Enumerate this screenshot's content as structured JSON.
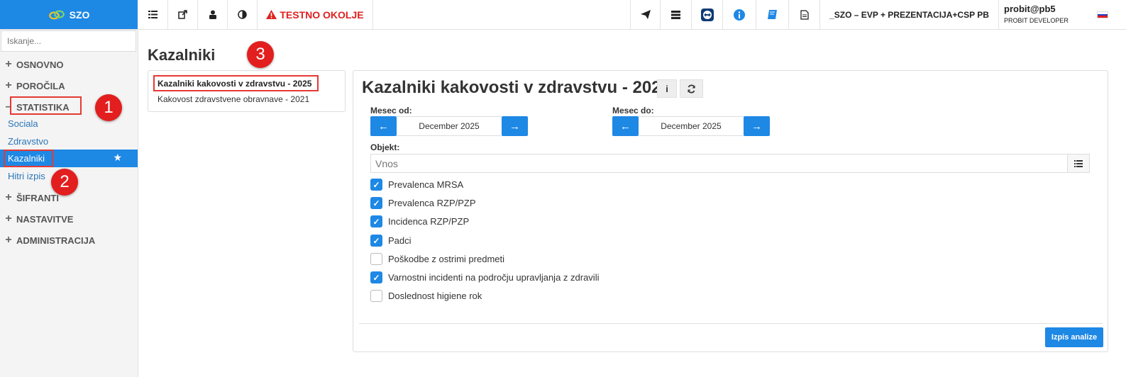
{
  "app": {
    "logo_text": "SZO"
  },
  "topbar": {
    "icons": [
      "list-icon",
      "external-link-icon",
      "lock-user-icon",
      "contrast-icon"
    ],
    "env_warning": "TESTNO OKOLJE",
    "right_icons": [
      "send-icon",
      "server-icon",
      "teamviewer-icon",
      "info-icon",
      "book-icon",
      "document-icon"
    ],
    "env_name": "_SZO – EVP + PREZENTACIJA+CSP PB",
    "user_name": "probit@pb5",
    "user_role": "PROBIT DEVELOPER",
    "flag_colors": [
      "#ffffff",
      "#1e40c0",
      "#e02020"
    ]
  },
  "sidebar": {
    "search_placeholder": "Iskanje...",
    "sections": {
      "osnovno": "OSNOVNO",
      "porocila": "POROČILA",
      "statistika": "STATISTIKA",
      "sifranti": "ŠIFRANTI",
      "nastavitve": "NASTAVITVE",
      "administracija": "ADMINISTRACIJA"
    },
    "items": {
      "sociala": "Sociala",
      "zdravstvo": "Zdravstvo",
      "kazalniki": "Kazalniki",
      "hitri_izpis": "Hitri izpis"
    }
  },
  "annotations": {
    "b1": "1",
    "b2": "2",
    "b3": "3",
    "color": "#e31e1e"
  },
  "page": {
    "title": "Kazalniki",
    "list": [
      "Kazalniki kakovosti v zdravstvu - 2025",
      "Kakovost zdravstvene obravnave - 2021"
    ]
  },
  "panel": {
    "title": "Kazalniki kakovosti v zdravstvu - 2025",
    "mesec_od_label": "Mesec od:",
    "mesec_od_value": "December 2025",
    "mesec_do_label": "Mesec do:",
    "mesec_do_value": "December 2025",
    "objekt_label": "Objekt:",
    "objekt_placeholder": "Vnos",
    "checkboxes": [
      {
        "label": "Prevalenca MRSA",
        "checked": true
      },
      {
        "label": "Prevalenca RZP/PZP",
        "checked": true
      },
      {
        "label": "Incidenca RZP/PZP",
        "checked": true
      },
      {
        "label": "Padci",
        "checked": true
      },
      {
        "label": "Poškodbe z ostrimi predmeti",
        "checked": false
      },
      {
        "label": "Varnostni incidenti na področju upravljanja z zdravili",
        "checked": true
      },
      {
        "label": "Doslednost higiene rok",
        "checked": false
      }
    ],
    "submit_label": "Izpis analize"
  },
  "colors": {
    "accent": "#1e88e5",
    "warning": "#e02020"
  }
}
